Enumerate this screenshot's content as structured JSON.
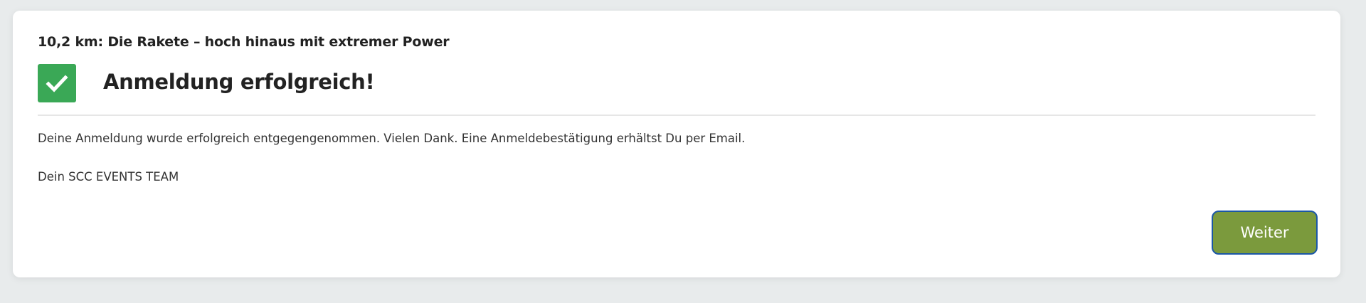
{
  "card": {
    "course_title": "10,2 km: Die Rakete – hoch hinaus mit extremer Power",
    "success_heading": "Anmeldung erfolgreich!",
    "message": "Deine Anmeldung wurde erfolgreich entgegengenommen. Vielen Dank. Eine Anmeldebestätigung erhältst Du per Email.",
    "signature": "Dein SCC EVENTS TEAM",
    "next_button_label": "Weiter",
    "icon": "checkmark-icon"
  },
  "colors": {
    "page_background": "#e8ebec",
    "card_background": "#ffffff",
    "success_green": "#3aa856",
    "button_olive": "#7b9a3d",
    "button_border_blue": "#1b57a6"
  }
}
